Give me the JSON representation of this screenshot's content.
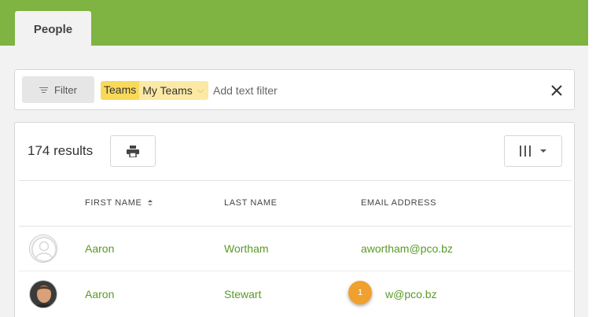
{
  "tabs": [
    {
      "label": "People"
    }
  ],
  "filter": {
    "button_label": "Filter",
    "chip": {
      "key": "Teams",
      "value": "My Teams"
    },
    "text_placeholder": "Add text filter"
  },
  "results": {
    "count_label": "174 results",
    "columns": [
      "FIRST NAME",
      "LAST NAME",
      "EMAIL ADDRESS"
    ],
    "rows": [
      {
        "first": "Aaron",
        "last": "Wortham",
        "email": "awortham@pco.bz",
        "avatar": "default"
      },
      {
        "first": "Aaron",
        "last": "Stewart",
        "email": "w@pco.bz",
        "avatar": "photo"
      }
    ]
  },
  "badge": {
    "label": "1"
  },
  "colors": {
    "brand_green": "#7fb342",
    "link_green": "#5a9a25",
    "chip_key": "#f9d95a",
    "chip_value": "#fbe9a5",
    "badge": "#f0a02c"
  }
}
